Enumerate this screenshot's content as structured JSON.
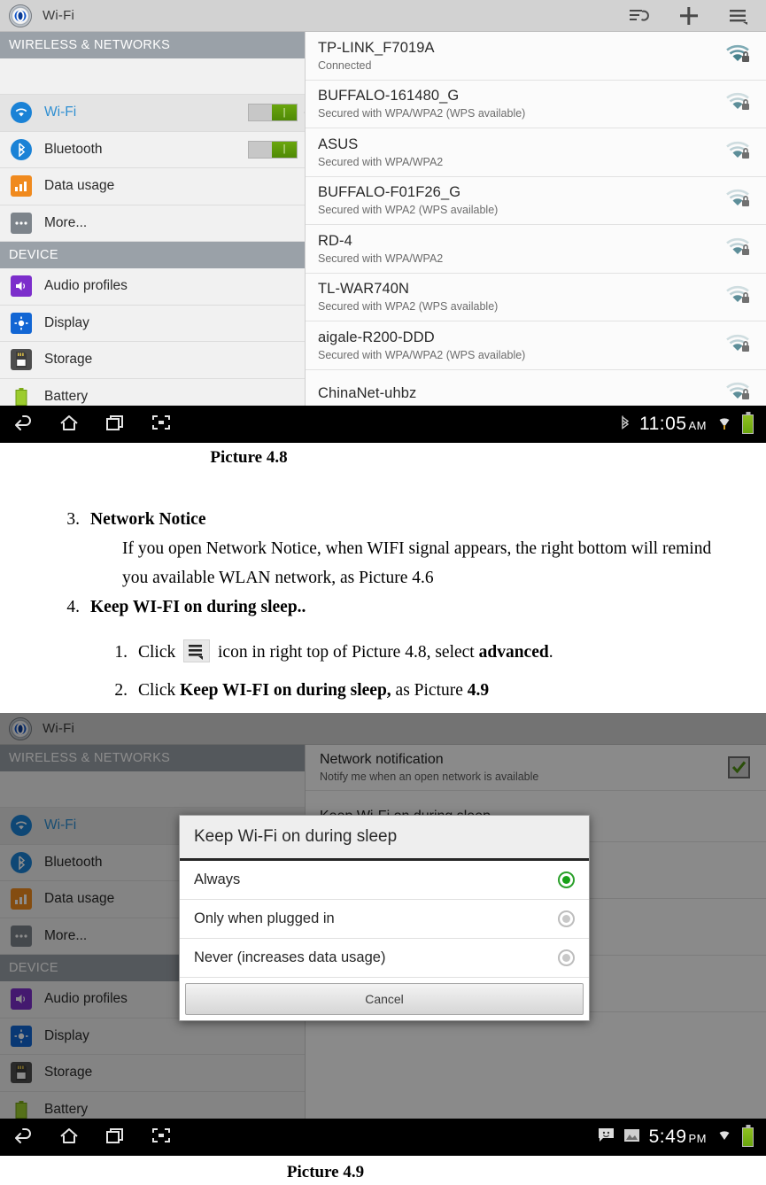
{
  "screenshot_1": {
    "action_bar": {
      "app_title": "Wi-Fi",
      "actions": [
        {
          "name": "wps-scan-icon",
          "label": "wps-scan"
        },
        {
          "name": "add-network-icon",
          "label": "add"
        },
        {
          "name": "overflow-menu-icon",
          "label": "menu"
        }
      ]
    },
    "sidebar": {
      "sections": [
        {
          "header": "WIRELESS & NETWORKS",
          "items": [
            {
              "label": "Wi-Fi",
              "icon": "wifi-icon",
              "toggle": "ON",
              "selected": true
            },
            {
              "label": "Bluetooth",
              "icon": "bluetooth-icon",
              "toggle": "ON",
              "selected": false
            },
            {
              "label": "Data usage",
              "icon": "data-usage-icon",
              "selected": false
            },
            {
              "label": "More...",
              "icon": "more-icon",
              "selected": false
            }
          ]
        },
        {
          "header": "DEVICE",
          "items": [
            {
              "label": "Audio profiles",
              "icon": "audio-profiles-icon",
              "selected": false
            },
            {
              "label": "Display",
              "icon": "display-icon",
              "selected": false
            },
            {
              "label": "Storage",
              "icon": "storage-icon",
              "selected": false
            },
            {
              "label": "Battery",
              "icon": "battery-icon",
              "selected": false
            }
          ]
        }
      ]
    },
    "networks": [
      {
        "ssid": "TP-LINK_F7019A",
        "status": "Connected",
        "signal": "strong",
        "secured": true
      },
      {
        "ssid": "BUFFALO-161480_G",
        "status": "Secured with WPA/WPA2 (WPS available)",
        "signal": "weak",
        "secured": true
      },
      {
        "ssid": "ASUS",
        "status": "Secured with WPA/WPA2",
        "signal": "weak",
        "secured": true
      },
      {
        "ssid": "BUFFALO-F01F26_G",
        "status": "Secured with WPA2 (WPS available)",
        "signal": "weak",
        "secured": true
      },
      {
        "ssid": "RD-4",
        "status": "Secured with WPA/WPA2",
        "signal": "weak",
        "secured": true
      },
      {
        "ssid": "TL-WAR740N",
        "status": "Secured with WPA2 (WPS available)",
        "signal": "weak",
        "secured": true
      },
      {
        "ssid": "aigale-R200-DDD",
        "status": "Secured with WPA/WPA2 (WPS available)",
        "signal": "weak",
        "secured": true
      },
      {
        "ssid": "ChinaNet-uhbz",
        "status": "",
        "signal": "weak",
        "secured": true
      }
    ],
    "nav_bar": {
      "buttons": [
        "back-icon",
        "home-icon",
        "recents-icon",
        "screenshot-icon"
      ],
      "status_icons": [
        "bluetooth-status-icon",
        "wifi-status-icon"
      ],
      "time": "11:05",
      "ampm": "AM"
    }
  },
  "caption_1": "Picture 4.8",
  "document": {
    "item3": {
      "num": "3.",
      "title": "Network Notice",
      "paragraph": "If you open Network Notice, when WIFI signal appears, the right bottom will remind you available WLAN network, as Picture 4.6"
    },
    "item4": {
      "num": "4.",
      "title": "Keep WI-FI on during sleep..",
      "steps": [
        {
          "num": "1.",
          "pre": "Click",
          "icon": "overflow-menu-icon",
          "mid": "icon in right top of Picture 4.8, select ",
          "bold": "advanced",
          "post": "."
        },
        {
          "num": "2.",
          "pre": "Click ",
          "bold": "Keep WI-FI on during sleep,",
          "mid": " as Picture ",
          "bold2": "4.9"
        }
      ]
    }
  },
  "screenshot_2": {
    "action_bar": {
      "app_title": "Wi-Fi"
    },
    "sidebar": {
      "sections": [
        {
          "header": "WIRELESS & NETWORKS",
          "items": [
            {
              "label": "Wi-Fi",
              "icon": "wifi-icon",
              "selected": true
            },
            {
              "label": "Bluetooth",
              "icon": "bluetooth-icon"
            },
            {
              "label": "Data usage",
              "icon": "data-usage-icon"
            },
            {
              "label": "More...",
              "icon": "more-icon"
            }
          ]
        },
        {
          "header": "DEVICE",
          "items": [
            {
              "label": "Audio profiles",
              "icon": "audio-profiles-icon"
            },
            {
              "label": "Display",
              "icon": "display-icon"
            },
            {
              "label": "Storage",
              "icon": "storage-icon"
            },
            {
              "label": "Battery",
              "icon": "battery-icon"
            }
          ]
        }
      ]
    },
    "settings": [
      {
        "title": "Network notification",
        "sub": "Notify me when an open network is available",
        "checked": true
      },
      {
        "title": "Keep Wi-Fi on during sleep",
        "sub": ""
      }
    ],
    "dialog": {
      "title": "Keep Wi-Fi on during sleep",
      "options": [
        {
          "label": "Always",
          "selected": true
        },
        {
          "label": "Only when plugged in",
          "selected": false
        },
        {
          "label": "Never (increases data usage)",
          "selected": false
        }
      ],
      "cancel_label": "Cancel"
    },
    "nav_bar": {
      "buttons": [
        "back-icon",
        "home-icon",
        "recents-icon",
        "screenshot-icon"
      ],
      "status_icons": [
        "message-icon",
        "screenshot-saved-icon",
        "wifi-status-icon"
      ],
      "time": "5:49",
      "ampm": "PM"
    }
  },
  "caption_2": "Picture 4.9",
  "colors": {
    "accent_blue": "#2f8fd2",
    "section_header": "#9aa1a8",
    "toggle_on": "#5f9a0a",
    "radio_on": "#17a117",
    "nav_bar": "#000000",
    "wifi_icon": "#6d9aa0"
  }
}
